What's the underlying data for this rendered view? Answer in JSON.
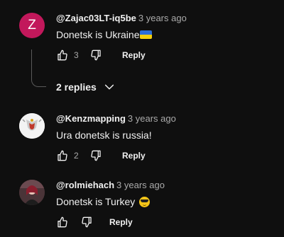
{
  "comments": [
    {
      "avatar_letter": "Z",
      "avatar_color": "#c2185b",
      "author": "@Zajac03LT-iq5be",
      "time": "3 years ago",
      "text": "Donetsk is Ukraine",
      "emoji": "ukraine-flag",
      "likes": "3",
      "reply_label": "Reply"
    },
    {
      "author": "@Kenzmapping",
      "time": "3 years ago",
      "text": "Ura donetsk is russia!",
      "likes": "2",
      "reply_label": "Reply"
    },
    {
      "author": "@rolmiehach",
      "time": "3 years ago",
      "text": "Donetsk is Turkey",
      "emoji": "smiling-face-with-sunglasses",
      "likes": "",
      "reply_label": "Reply"
    }
  ],
  "replies_toggle": {
    "label": "2 replies"
  }
}
